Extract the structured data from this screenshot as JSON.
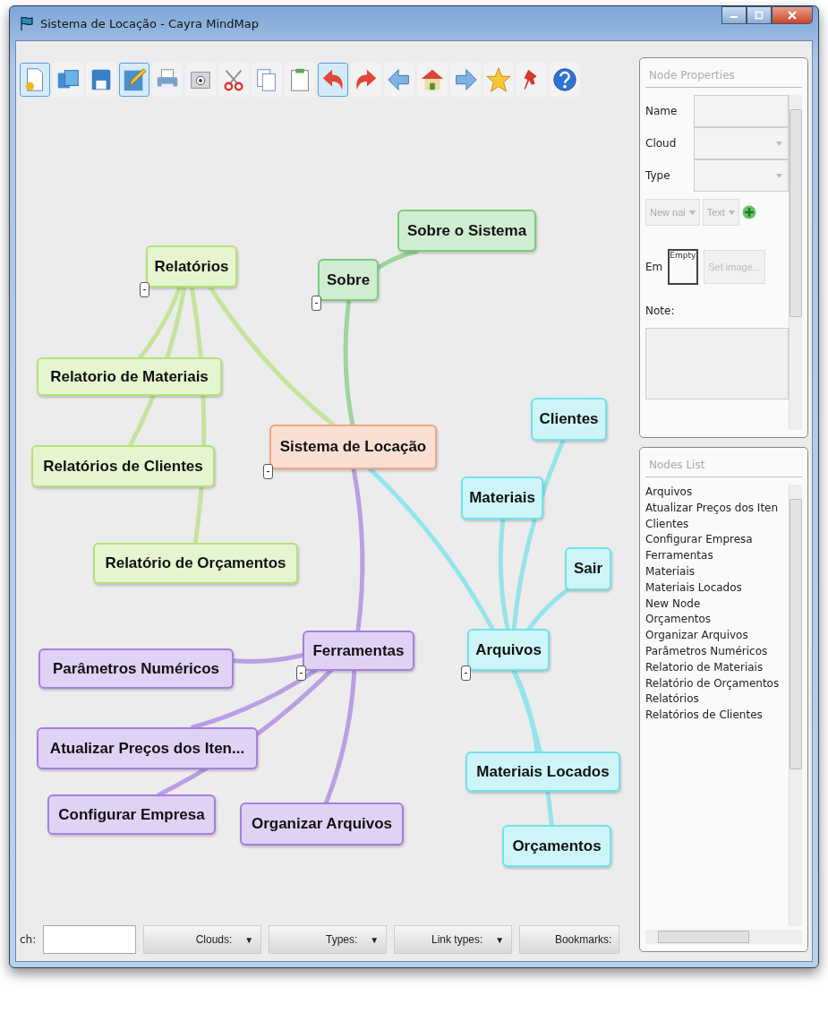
{
  "window": {
    "title": "Sistema de Locação - Cayra MindMap"
  },
  "toolbar": [
    {
      "kind": "new",
      "selected": true
    },
    {
      "kind": "open",
      "selected": false
    },
    {
      "kind": "save",
      "selected": false
    },
    {
      "kind": "edit",
      "selected": true
    },
    {
      "kind": "print",
      "selected": false
    },
    {
      "kind": "camera",
      "selected": false
    },
    {
      "kind": "cut",
      "selected": false
    },
    {
      "kind": "copy",
      "selected": false
    },
    {
      "kind": "paste",
      "selected": false
    },
    {
      "kind": "undo",
      "selected": true
    },
    {
      "kind": "redo",
      "selected": false
    },
    {
      "kind": "back",
      "selected": false
    },
    {
      "kind": "home",
      "selected": false
    },
    {
      "kind": "forward",
      "selected": false
    },
    {
      "kind": "star",
      "selected": false
    },
    {
      "kind": "pin",
      "selected": false
    },
    {
      "kind": "help",
      "selected": false
    }
  ],
  "mindmap": {
    "label": "Sistema de Locação",
    "color": "#f0a584",
    "toggle": "-",
    "children": [
      {
        "label": "Relatórios",
        "color": "#b4e27a",
        "toggle": "-",
        "children": [
          {
            "label": "Relatorio de Materiais"
          },
          {
            "label": "Relatórios de Clientes"
          },
          {
            "label": "Relatório de Orçamentos"
          }
        ]
      },
      {
        "label": "Sobre",
        "color": "#7ccb7c",
        "toggle": "-",
        "children": [
          {
            "label": "Sobre o Sistema"
          }
        ]
      },
      {
        "label": "Ferramentas",
        "color": "#a67fe2",
        "toggle": "-",
        "children": [
          {
            "label": "Parâmetros Numéricos"
          },
          {
            "label": "Atualizar Preços dos Iten..."
          },
          {
            "label": "Configurar Empresa"
          },
          {
            "label": "Organizar Arquivos"
          }
        ]
      },
      {
        "label": "Arquivos",
        "color": "#6fe3ea",
        "toggle": "-",
        "children": [
          {
            "label": "Clientes"
          },
          {
            "label": "Materiais"
          },
          {
            "label": "Sair"
          },
          {
            "label": "Materiais Locados"
          },
          {
            "label": "Orçamentos"
          }
        ]
      }
    ]
  },
  "bottom_bar": {
    "search_label": "ch:",
    "filters": [
      {
        "label": "Clouds:",
        "arrow": "▼"
      },
      {
        "label": "Types:",
        "arrow": "▼"
      },
      {
        "label": "Link types:",
        "arrow": "▼"
      },
      {
        "label": "Bookmarks:"
      }
    ]
  },
  "node_properties": {
    "title": "Node Properties",
    "fields": [
      {
        "label": "Name",
        "kind": "text"
      },
      {
        "label": "Cloud",
        "kind": "select"
      },
      {
        "label": "Type",
        "kind": "select"
      }
    ],
    "attr_name": "New nai",
    "attr_type": "Text",
    "image_label": "Em",
    "image_box": "Empty",
    "image_button": "Set image...",
    "image_button_disabled": true,
    "note_label": "Note:"
  },
  "nodes_list": {
    "title": "Nodes List",
    "items": [
      "Arquivos",
      "Atualizar Preços dos Iten",
      "Clientes",
      "Configurar Empresa",
      "Ferramentas",
      "Materiais",
      "Materiais Locados",
      "New Node",
      "Orçamentos",
      "Organizar Arquivos",
      "Parâmetros Numéricos",
      "Relatorio de Materiais",
      "Relatório de Orçamentos",
      "Relatórios",
      "Relatórios de Clientes"
    ]
  }
}
